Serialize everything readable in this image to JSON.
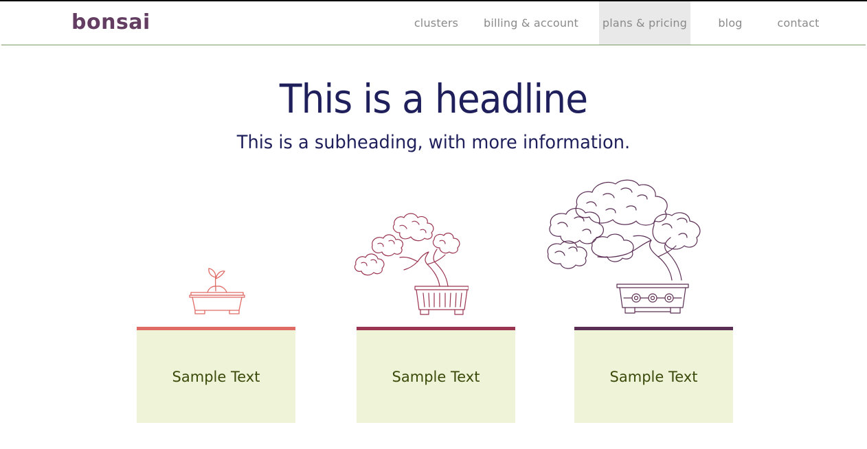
{
  "brand": {
    "logo_text": "bonsai",
    "colors": {
      "logo": "#633e62",
      "nav_text": "#8a8a8a",
      "nav_active_bg": "#e9e9e9",
      "nav_border": "#7a9a67",
      "headline": "#1f1f5c",
      "card_bg": "#eff3d8",
      "card_text": "#3a4a0a"
    }
  },
  "nav": {
    "items": [
      {
        "label": "clusters",
        "active": false
      },
      {
        "label": "billing & account",
        "active": false
      },
      {
        "label": "plans & pricing",
        "active": true
      },
      {
        "label": "blog",
        "active": false
      },
      {
        "label": "contact",
        "active": false
      }
    ]
  },
  "hero": {
    "headline": "This is a headline",
    "subheading": "This is a subheading, with more information."
  },
  "plans": [
    {
      "illustration": "sprout-pot-icon",
      "accent": "#e06a64",
      "text": "Sample Text"
    },
    {
      "illustration": "small-bonsai-tree-icon",
      "accent": "#9a3450",
      "text": "Sample Text"
    },
    {
      "illustration": "large-bonsai-tree-icon",
      "accent": "#5a2d54",
      "text": "Sample Text"
    }
  ]
}
